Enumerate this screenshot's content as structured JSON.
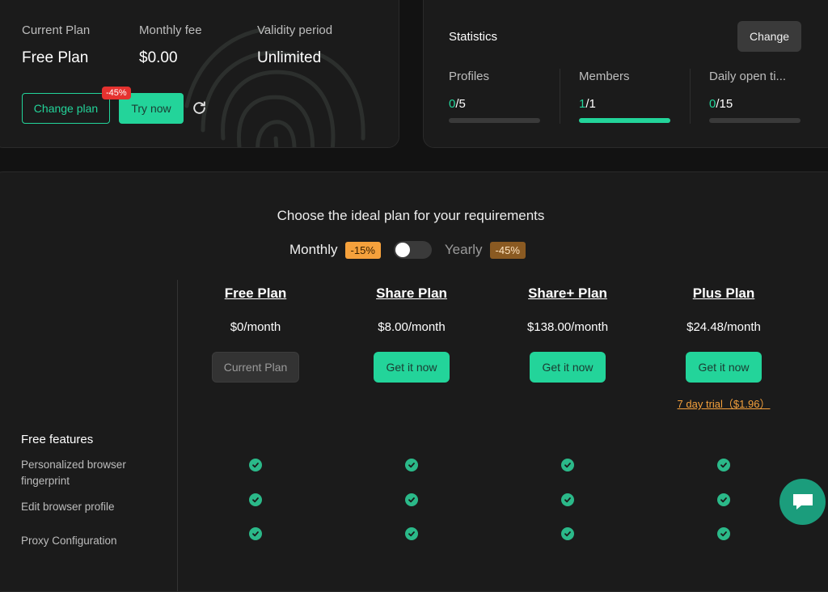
{
  "current_plan": {
    "labels": {
      "plan": "Current Plan",
      "fee": "Monthly fee",
      "validity": "Validity period"
    },
    "values": {
      "plan": "Free Plan",
      "fee": "$0.00",
      "validity": "Unlimited"
    },
    "change_plan_label": "Change plan",
    "try_now_label": "Try now",
    "discount_badge": "-45%"
  },
  "statistics": {
    "title": "Statistics",
    "change_label": "Change",
    "items": [
      {
        "label": "Profiles",
        "used": "0",
        "total": "/5",
        "progress": 0
      },
      {
        "label": "Members",
        "used": "1",
        "total": "/1",
        "progress": 1
      },
      {
        "label": "Daily open ti...",
        "used": "0",
        "total": "/15",
        "progress": 0
      }
    ]
  },
  "pricing": {
    "title": "Choose the ideal plan for your requirements",
    "monthly_label": "Monthly",
    "monthly_discount": "-15%",
    "yearly_label": "Yearly",
    "yearly_discount": "-45%",
    "plans": [
      {
        "name": "Free Plan",
        "price": "$0/month",
        "button": "Current Plan"
      },
      {
        "name": "Share Plan",
        "price": "$8.00/month",
        "button": "Get it now"
      },
      {
        "name": "Share+ Plan",
        "price": "$138.00/month",
        "button": "Get it now"
      },
      {
        "name": "Plus Plan",
        "price": "$24.48/month",
        "button": "Get it now",
        "trial": "7 day trial（$1.96）"
      }
    ],
    "features_title": "Free features",
    "features": [
      {
        "label": "Personalized browser fingerprint"
      },
      {
        "label": "Edit browser profile"
      },
      {
        "label": "Proxy Configuration"
      }
    ]
  },
  "colors": {
    "accent": "#23d49a",
    "background": "#121212",
    "card": "#1b1b1b",
    "badge_red": "#e5322f",
    "badge_orange": "#f5a13c"
  },
  "icons": [
    "refresh-icon",
    "fingerprint-icon",
    "check-icon",
    "chat-icon"
  ]
}
